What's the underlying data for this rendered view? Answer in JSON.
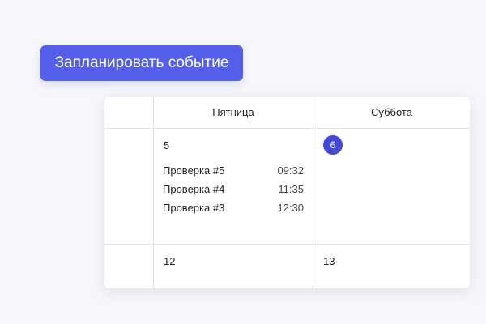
{
  "toolbar": {
    "schedule_label": "Запланировать событие"
  },
  "calendar": {
    "columns": [
      "Пятница",
      "Суббота"
    ],
    "week1": {
      "friday": "5",
      "saturday": "6"
    },
    "week2": {
      "friday": "12",
      "saturday": "13"
    },
    "events": [
      {
        "title": "Проверка #5",
        "time": "09:32"
      },
      {
        "title": "Проверка #4",
        "time": "11:35"
      },
      {
        "title": "Проверка #3",
        "time": "12:30"
      }
    ]
  },
  "colors": {
    "accent": "#5560ea",
    "today": "#4348d6"
  }
}
